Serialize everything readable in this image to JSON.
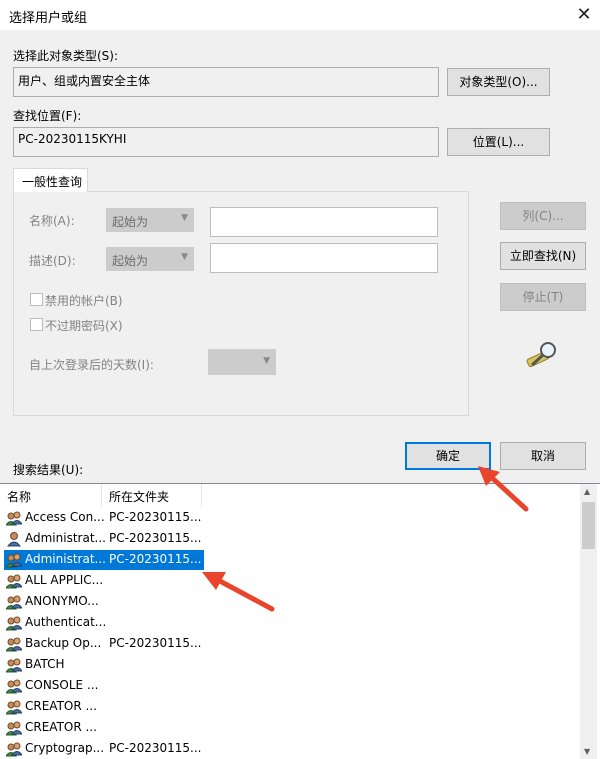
{
  "window": {
    "title": "选择用户或组",
    "close_label": "✕"
  },
  "object_type": {
    "label": "选择此对象类型(S):",
    "value": "用户、组或内置安全主体",
    "button": "对象类型(O)..."
  },
  "location": {
    "label": "查找位置(F):",
    "value": "PC-20230115KYHI",
    "button": "位置(L)..."
  },
  "query": {
    "tab": "一般性查询",
    "name_label": "名称(A):",
    "name_combo": "起始为",
    "desc_label": "描述(D):",
    "desc_combo": "起始为",
    "disabled_accounts": "禁用的帐户(B)",
    "non_expiring_pw": "不过期密码(X)",
    "days_label": "自上次登录后的天数(I):"
  },
  "buttons": {
    "columns": "列(C)...",
    "find_now": "立即查找(N)",
    "stop": "停止(T)",
    "ok": "确定",
    "cancel": "取消"
  },
  "results": {
    "label": "搜索结果(U):",
    "columns": [
      "名称",
      "所在文件夹"
    ],
    "rows": [
      {
        "name": "Access Con...",
        "folder": "PC-20230115...",
        "icon": "group-icon"
      },
      {
        "name": "Administrat...",
        "folder": "PC-20230115...",
        "icon": "user-icon"
      },
      {
        "name": "Administrat...",
        "folder": "PC-20230115...",
        "icon": "group-icon",
        "selected": true
      },
      {
        "name": "ALL APPLIC...",
        "folder": "",
        "icon": "group-icon"
      },
      {
        "name": "ANONYMO...",
        "folder": "",
        "icon": "group-icon"
      },
      {
        "name": "Authenticat...",
        "folder": "",
        "icon": "group-icon"
      },
      {
        "name": "Backup Op...",
        "folder": "PC-20230115...",
        "icon": "group-icon"
      },
      {
        "name": "BATCH",
        "folder": "",
        "icon": "group-icon"
      },
      {
        "name": "CONSOLE ...",
        "folder": "",
        "icon": "group-icon"
      },
      {
        "name": "CREATOR ...",
        "folder": "",
        "icon": "group-icon"
      },
      {
        "name": "CREATOR ...",
        "folder": "",
        "icon": "group-icon"
      },
      {
        "name": "Cryptograp...",
        "folder": "PC-20230115...",
        "icon": "group-icon"
      }
    ]
  },
  "colors": {
    "accent": "#0078d7",
    "arrow": "#e8452c"
  }
}
